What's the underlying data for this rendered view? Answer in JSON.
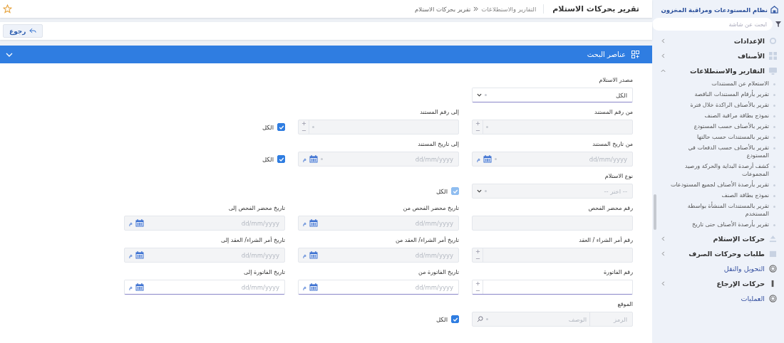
{
  "sidebar": {
    "system_title": "نظام المستودعات ومراقبة المخزون",
    "search": {
      "placeholder": "ابحث عن شاشة"
    },
    "items": [
      {
        "kind": "group",
        "label": "الإعدادات",
        "expanded": false
      },
      {
        "kind": "group",
        "label": "الأصناف",
        "expanded": false
      },
      {
        "kind": "group",
        "label": "التقارير والاستطلاعات",
        "expanded": true,
        "children": [
          {
            "label": "الاستعلام عن المستندات"
          },
          {
            "label": "تقرير بأرقام المستندات الناقصة"
          },
          {
            "label": "تقرير بالأصناف الراكدة خلال فترة"
          },
          {
            "label": "نموذج بطاقة مراقبة الصنف"
          },
          {
            "label": "تقرير بالأصناف حسب المستودع"
          },
          {
            "label": "تقرير بالمستندات حسب حالتها"
          },
          {
            "label": "تقرير بالأصناف حسب الدفعات في المستودع"
          },
          {
            "label": "كشف أرصدة البداية والحركة ورصيد المجموعات"
          },
          {
            "label": "تقرير بأرصدة الأصناف لجميع المستودعات"
          },
          {
            "label": "نموذج بطاقة الصنف"
          },
          {
            "label": "تقرير بالمستندات المنشأة بواسطة المستخدم"
          },
          {
            "label": "تقرير بأرصدة الأصناف حتى تاريخ"
          }
        ]
      },
      {
        "kind": "group",
        "label": "حركات الإستلام",
        "expanded": false
      },
      {
        "kind": "group",
        "label": "طلبات وحركات الصرف",
        "expanded": false
      },
      {
        "kind": "link",
        "label": "التحويل والنقل"
      },
      {
        "kind": "group",
        "label": "حركات الإرجاع",
        "expanded": false
      },
      {
        "kind": "link",
        "label": "العمليات"
      }
    ]
  },
  "header": {
    "title": "تقرير بحركات الاستلام",
    "breadcrumb": [
      "التقارير والاستطلاعات",
      "تقرير بحركات الاستلام"
    ]
  },
  "toolbar": {
    "back_button": "رجوع"
  },
  "panel": {
    "title": "عناصر البحث",
    "expanded": true
  },
  "form": {
    "rows": [
      {
        "cells": [
          {
            "kind": "select",
            "label": "مصدر الاستلام",
            "value": "الكل",
            "disabled": false,
            "clearable": true
          }
        ]
      },
      {
        "cells": [
          {
            "kind": "number",
            "label": "من رقم المستند",
            "disabled": true,
            "clearable": true
          },
          {
            "kind": "number",
            "label": "إلى رقم المستند",
            "disabled": true,
            "clearable": true
          },
          {
            "kind": "checkbox",
            "label": "الكل",
            "checked": true,
            "disabled": false
          }
        ]
      },
      {
        "cells": [
          {
            "kind": "date",
            "label": "من تاريخ المستند",
            "placeholder": "dd/mm/yyyy",
            "suffix": "م",
            "disabled": true,
            "clearable": true
          },
          {
            "kind": "date",
            "label": "إلى تاريخ المستند",
            "placeholder": "dd/mm/yyyy",
            "suffix": "م",
            "disabled": true,
            "clearable": true
          },
          {
            "kind": "checkbox",
            "label": "الكل",
            "checked": true,
            "disabled": false
          }
        ]
      },
      {
        "cells": [
          {
            "kind": "select",
            "label": "نوع الاستلام",
            "placeholder": "-- اختر --",
            "disabled": true,
            "clearable": true
          },
          {
            "kind": "checkbox",
            "label": "الكل",
            "checked": true,
            "disabled": true
          }
        ]
      },
      {
        "cells": [
          {
            "kind": "text",
            "label": "رقم محضر الفحص",
            "disabled": true
          },
          {
            "kind": "date",
            "label": "تاريخ محضر الفحص من",
            "placeholder": "dd/mm/yyyy",
            "suffix": "م",
            "disabled": true,
            "clearable": false
          },
          {
            "kind": "date",
            "label": "تاريخ محضر الفحص إلى",
            "placeholder": "dd/mm/yyyy",
            "suffix": "م",
            "disabled": true,
            "clearable": false
          }
        ]
      },
      {
        "cells": [
          {
            "kind": "number",
            "label": "رقم أمر الشراء / العقد",
            "disabled": true,
            "clearable": false
          },
          {
            "kind": "date",
            "label": "تاريخ أمر الشراء/ العقد من",
            "placeholder": "dd/mm/yyyy",
            "suffix": "م",
            "disabled": true,
            "clearable": false
          },
          {
            "kind": "date",
            "label": "تاريخ أمر الشراء/ العقد إلى",
            "placeholder": "dd/mm/yyyy",
            "suffix": "م",
            "disabled": true,
            "clearable": false
          }
        ]
      },
      {
        "cells": [
          {
            "kind": "number",
            "label": "رقم الفاتورة",
            "disabled": false,
            "clearable": false
          },
          {
            "kind": "date",
            "label": "تاريخ الفاتورة من",
            "placeholder": "dd/mm/yyyy",
            "suffix": "م",
            "disabled": false,
            "clearable": false
          },
          {
            "kind": "date",
            "label": "تاريخ الفاتورة إلى",
            "placeholder": "dd/mm/yyyy",
            "suffix": "م",
            "disabled": false,
            "clearable": false
          }
        ]
      },
      {
        "cells": [
          {
            "kind": "lookup",
            "label": "الموقع",
            "code_placeholder": "الرمز",
            "description_placeholder": "الوصف",
            "disabled": true,
            "clearable": true
          },
          {
            "kind": "checkbox",
            "label": "الكل",
            "checked": true,
            "disabled": false
          }
        ]
      }
    ]
  }
}
